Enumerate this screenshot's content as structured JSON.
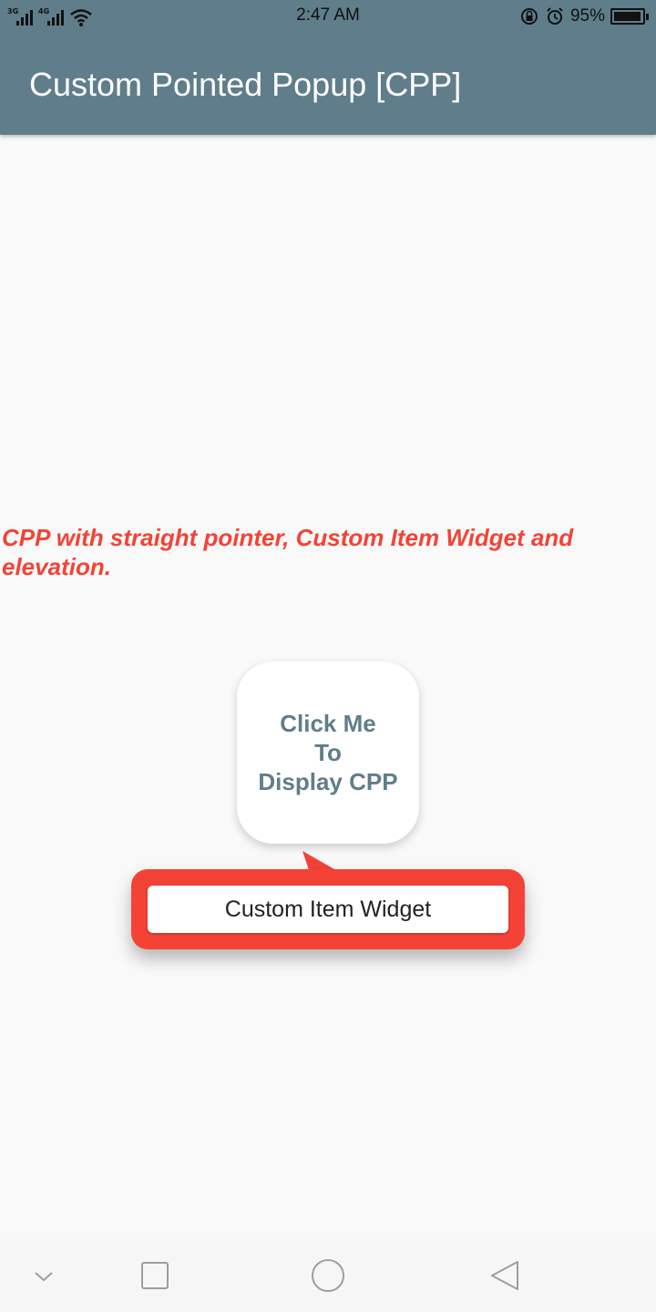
{
  "status_bar": {
    "signal1_label": "3G",
    "signal2_label": "4G",
    "time": "2:47 AM",
    "battery_percent": "95%",
    "battery_level": 0.95
  },
  "app_bar": {
    "title": "Custom Pointed Popup [CPP]",
    "color": "#607d8b"
  },
  "main": {
    "description": "CPP with straight pointer, Custom Item Widget and elevation.",
    "description_color": "#f44336",
    "target_button": {
      "lines": [
        "Click Me",
        "To",
        "Display CPP"
      ]
    },
    "popup": {
      "item_label": "Custom Item Widget",
      "color": "#f44336"
    }
  },
  "nav_bar": {
    "icons": [
      "chevron-down-icon",
      "recent-apps-icon",
      "home-icon",
      "back-icon"
    ]
  }
}
